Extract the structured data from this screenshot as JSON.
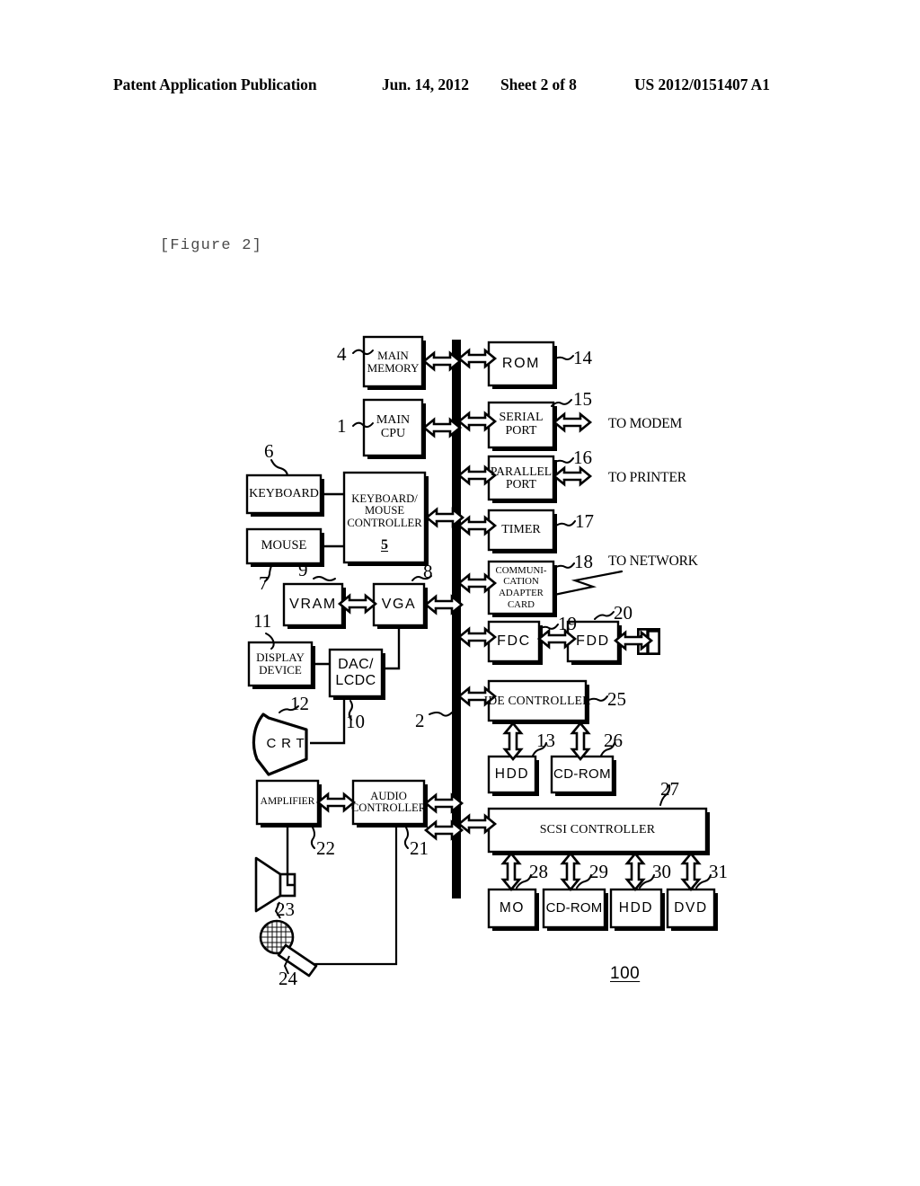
{
  "header": {
    "title": "Patent Application Publication",
    "date": "Jun. 14, 2012",
    "sheet": "Sheet 2 of 8",
    "doc_number": "US 2012/0151407 A1"
  },
  "figure": {
    "caption": "[Figure 2]",
    "assembly_label": "100"
  },
  "blocks": {
    "main_memory": "MAIN\nMEMORY",
    "main_cpu": "MAIN\nCPU",
    "keyboard": "KEYBOARD",
    "mouse": "MOUSE",
    "km_controller": "KEYBOARD/\nMOUSE\nCONTROLLER",
    "km_controller_ref": "5",
    "vram": "VRAM",
    "vga": "VGA",
    "display_device": "DISPLAY\nDEVICE",
    "dac_lcdc": "DAC/\nLCDC",
    "crt": "C R T",
    "amplifier": "AMPLIFIER",
    "audio_controller": "AUDIO\nCONTROLLER",
    "rom": "ROM",
    "serial_port": "SERIAL\nPORT",
    "parallel_port": "PARALLEL\nPORT",
    "timer": "TIMER",
    "comm_adapter": "COMMUNI-\nCATION\nADAPTER\nCARD",
    "fdc": "FDC",
    "fdd": "FDD",
    "ide_controller": "IDE CONTROLLER",
    "hdd_ide": "HDD",
    "cdrom_ide": "CD-ROM",
    "scsi_controller": "SCSI CONTROLLER",
    "scsi_mo": "MO",
    "scsi_cdrom": "CD-ROM",
    "scsi_hdd": "HDD",
    "scsi_dvd": "DVD"
  },
  "annotations": {
    "to_modem": "TO MODEM",
    "to_printer": "TO PRINTER",
    "to_network": "TO NETWORK"
  },
  "reference_numbers": {
    "main_cpu": "1",
    "bus": "2",
    "hdd_ide": "13",
    "main_memory": "4",
    "keyboard": "6",
    "mouse": "7",
    "vga": "8",
    "vram": "9",
    "dac_lcdc": "10",
    "display_device": "11",
    "crt": "12",
    "rom": "14",
    "serial_port": "15",
    "parallel_port": "16",
    "timer": "17",
    "comm_adapter": "18",
    "fdc": "19",
    "fdd": "20",
    "audio_controller": "21",
    "amplifier": "22",
    "speaker": "23",
    "microphone": "24",
    "ide_controller": "25",
    "cdrom_ide": "26",
    "scsi_controller": "27",
    "scsi_mo": "28",
    "scsi_cdrom": "29",
    "scsi_hdd": "30",
    "scsi_dvd": "31"
  },
  "colors": {
    "ink": "#000000",
    "paper": "#ffffff",
    "caption": "#4a4a4a"
  }
}
